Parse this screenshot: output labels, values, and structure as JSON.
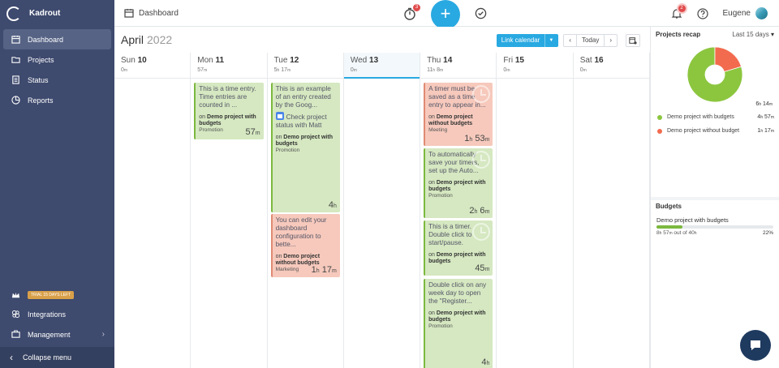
{
  "app": {
    "name": "Kadrout"
  },
  "sidebar": {
    "items": [
      {
        "label": "Dashboard",
        "icon": "calendar-icon",
        "active": true
      },
      {
        "label": "Projects",
        "icon": "folder-icon"
      },
      {
        "label": "Status",
        "icon": "list-icon"
      },
      {
        "label": "Reports",
        "icon": "chart-icon"
      }
    ],
    "trial_badge": "TRIAL 15 days left",
    "bottom_items": [
      {
        "label": "Integrations",
        "icon": "integrations-icon"
      },
      {
        "label": "Management",
        "icon": "briefcase-icon"
      }
    ],
    "collapse_label": "Collapse menu"
  },
  "topbar": {
    "breadcrumb": "Dashboard",
    "timer_badge": "3",
    "add_label": "+",
    "notif_badge": "2",
    "user_name": "Eugene"
  },
  "calendar": {
    "month": "April",
    "year": "2022",
    "link_label": "Link calendar",
    "today_label": "Today",
    "days": [
      {
        "name": "Sun",
        "num": "10",
        "total_h": "",
        "total_m": "0",
        "weekend": true,
        "today": false
      },
      {
        "name": "Mon",
        "num": "11",
        "total_h": "",
        "total_m": "57",
        "weekend": false,
        "today": false
      },
      {
        "name": "Tue",
        "num": "12",
        "total_h": "5",
        "total_m": "17",
        "weekend": false,
        "today": false
      },
      {
        "name": "Wed",
        "num": "13",
        "total_h": "",
        "total_m": "0",
        "weekend": false,
        "today": true
      },
      {
        "name": "Thu",
        "num": "14",
        "total_h": "11",
        "total_m": "8",
        "weekend": false,
        "today": false
      },
      {
        "name": "Fri",
        "num": "15",
        "total_h": "",
        "total_m": "0",
        "weekend": false,
        "today": false
      },
      {
        "name": "Sat",
        "num": "16",
        "total_h": "",
        "total_m": "0",
        "weekend": true,
        "today": false
      }
    ],
    "entries": {
      "mon": [
        {
          "desc": "This is a time entry. Time entries are counted in ...",
          "project": "Demo project with budgets",
          "tag": "Promotion",
          "dur_h": "",
          "dur_m": "57",
          "color": "green"
        }
      ],
      "tue": [
        {
          "desc": "This is an example of an entry created by the Goog...",
          "task": "Check project status with Matt",
          "project": "Demo project with budgets",
          "tag": "Promotion",
          "dur_h": "4",
          "dur_m": "",
          "color": "green"
        },
        {
          "desc": "You can edit your dashboard configuration to bette...",
          "project": "Demo project without budgets",
          "tag": "Marketing",
          "dur_h": "1",
          "dur_m": "17",
          "color": "red"
        }
      ],
      "thu": [
        {
          "desc": "A timer must be saved as a time entry to appear in...",
          "project": "Demo project without budgets",
          "tag": "Meeting",
          "dur_h": "1",
          "dur_m": "53",
          "color": "red"
        },
        {
          "desc": "To automatically save your timers, set up the Auto...",
          "project": "Demo project with budgets",
          "tag": "Promotion",
          "dur_h": "2",
          "dur_m": "6",
          "color": "green"
        },
        {
          "desc": "This is a timer. Double click to start/pause.",
          "project": "Demo project with budgets",
          "tag": "",
          "dur_h": "",
          "dur_m": "45",
          "color": "green"
        },
        {
          "desc": "Double click on any week day to open the \"Register...",
          "project": "Demo project with budgets",
          "tag": "Promotion",
          "dur_h": "4",
          "dur_m": "",
          "color": "green"
        }
      ]
    },
    "on_prefix": "on",
    "h_unit": "h",
    "m_unit": "m"
  },
  "recap": {
    "title": "Projects recap",
    "range": "Last 15 days",
    "total_h": "6",
    "total_m": "14",
    "legend": [
      {
        "name": "Demo project with budgets",
        "h": "4",
        "m": "57",
        "color": "#8cc63f",
        "fraction": 0.797
      },
      {
        "name": "Demo project without budget",
        "h": "1",
        "m": "17",
        "color": "#f26b4e",
        "fraction": 0.203
      }
    ]
  },
  "budgets": {
    "title": "Budgets",
    "name": "Demo project with budgets",
    "used_h": "8",
    "used_m": "57",
    "out_of_text": "out of",
    "total": "40",
    "percent_text": "22%",
    "fraction": 0.22
  }
}
